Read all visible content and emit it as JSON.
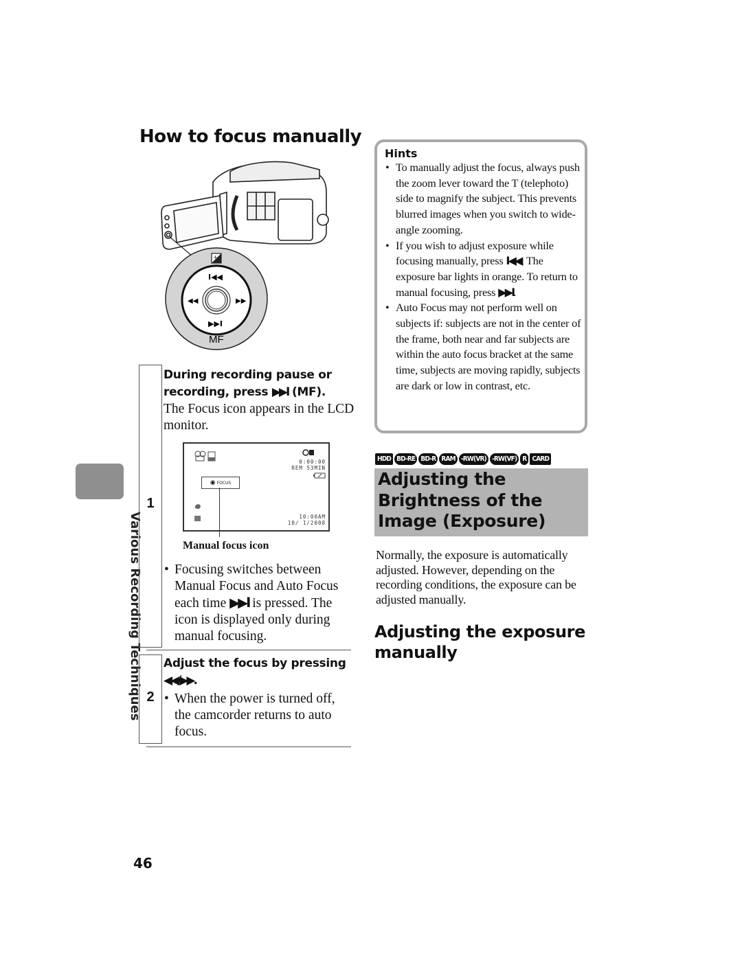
{
  "left_column": {
    "title": "How to focus manually",
    "camera_illustration": {
      "controller_labels": {
        "top": "+/- exposure",
        "up": "⏮",
        "left": "◀◀",
        "right": "▶▶",
        "down": "⏭",
        "bottom": "MF"
      }
    },
    "side_label": "Various Recording Techniques",
    "step1": {
      "number": "1",
      "heading_prefix": "During recording pause or recording, press ",
      "heading_button": "▶▶I",
      "heading_suffix": " (MF).",
      "text": "The Focus icon appears in the LCD monitor.",
      "lcd": {
        "time": "0:00:00",
        "remaining": "REM 53MIN",
        "clock": "10:00AM",
        "date": "10/  1/2008",
        "focus_box_label": "FOCUS"
      },
      "callout_label": "Manual focus icon",
      "bullets": [
        {
          "prefix": "Focusing switches between Manual Focus and Auto Focus each time ",
          "button": "▶▶I",
          "suffix": " is pressed. The icon is displayed only during manual focusing."
        }
      ]
    },
    "step2": {
      "number": "2",
      "heading_prefix": "Adjust the focus by pressing ",
      "heading_button": "◀◀/▶▶",
      "heading_suffix": ".",
      "bullets": [
        "When the power is turned off, the camcorder returns to auto focus."
      ]
    },
    "page_number": "46"
  },
  "right_column": {
    "hints": {
      "title": "Hints",
      "items": [
        "To manually adjust the focus, always push the zoom lever toward the T (telephoto) side to magnify the subject. This prevents blurred images when you switch to wide-angle zooming.",
        {
          "prefix": "If you wish to adjust exposure while focusing manually, press ",
          "button1": "I◀◀",
          "middle": ". The exposure bar lights in orange. To return to manual focusing, press ",
          "button2": "▶▶I",
          "suffix": "."
        },
        "Auto Focus may not perform well on subjects if: subjects are not in the center of the frame, both near and far subjects are within the auto focus bracket at the same time, subjects are moving rapidly, subjects are dark or low in contrast, etc."
      ]
    },
    "media_badges": [
      "HDD",
      "BD-RE",
      "BD-R",
      "RAM",
      "-RW(VR)",
      "-RW(VF)",
      "R",
      "CARD"
    ],
    "section_title_lines": [
      "Adjusting the",
      "Brightness of the",
      "Image (Exposure)"
    ],
    "intro_text": "Normally, the exposure is automatically adjusted. However, depending on the recording conditions, the exposure can be adjusted manually.",
    "subheading": "Adjusting the exposure manually"
  }
}
